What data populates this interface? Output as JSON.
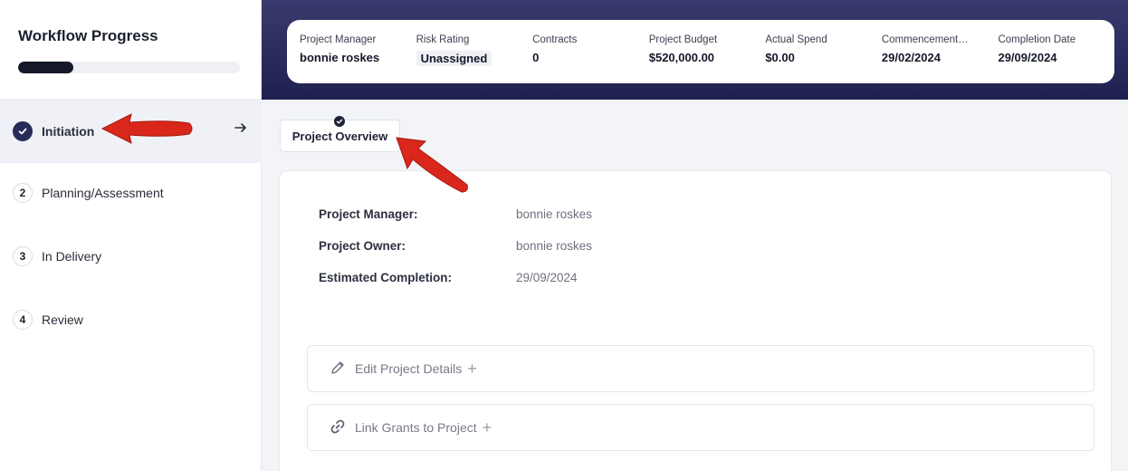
{
  "sidebar": {
    "title": "Workflow Progress",
    "progress_fraction": 0.25,
    "steps": [
      {
        "number": "",
        "label": "Initiation",
        "state": "completed"
      },
      {
        "number": "2",
        "label": "Planning/Assessment",
        "state": "pending"
      },
      {
        "number": "3",
        "label": "In Delivery",
        "state": "pending"
      },
      {
        "number": "4",
        "label": "Review",
        "state": "pending"
      }
    ]
  },
  "header": {
    "stats": [
      {
        "label": "Project Manager",
        "value": "bonnie roskes"
      },
      {
        "label": "Risk Rating",
        "value": "Unassigned"
      },
      {
        "label": "Contracts",
        "value": "0"
      },
      {
        "label": "Project Budget",
        "value": "$520,000.00"
      },
      {
        "label": "Actual Spend",
        "value": "$0.00"
      },
      {
        "label": "Commencement…",
        "value": "29/02/2024"
      },
      {
        "label": "Completion Date",
        "value": "29/09/2024"
      }
    ]
  },
  "main": {
    "tab_label": "Project Overview",
    "overview": [
      {
        "label": "Project Manager:",
        "value": "bonnie roskes"
      },
      {
        "label": "Project Owner:",
        "value": "bonnie roskes"
      },
      {
        "label": "Estimated Completion:",
        "value": "29/09/2024"
      }
    ],
    "actions": [
      {
        "label": "Edit Project Details",
        "icon": "pencil-icon"
      },
      {
        "label": "Link Grants to Project",
        "icon": "link-icon"
      }
    ]
  },
  "colors": {
    "header_gradient_top": "#3b3a6e",
    "header_gradient_bottom": "#1e2150",
    "annotation_arrow": "#d9271c",
    "step_done": "#272b58"
  }
}
